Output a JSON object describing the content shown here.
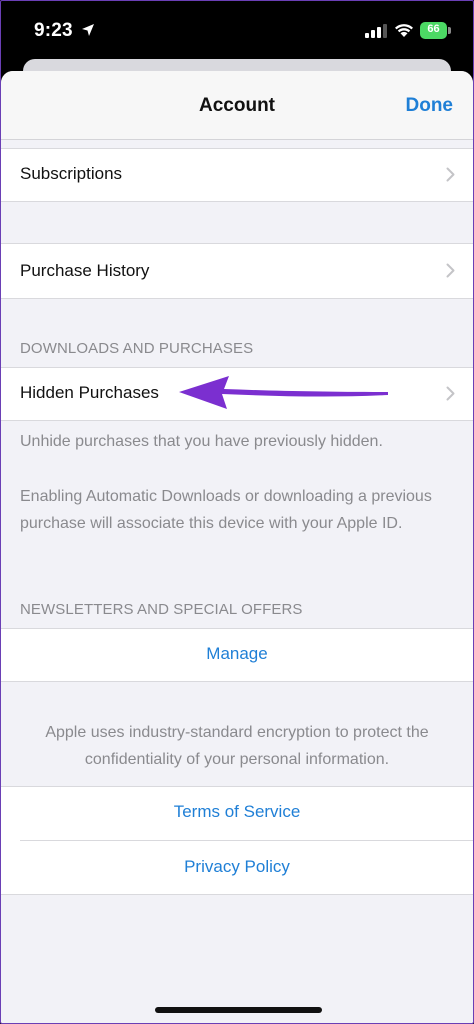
{
  "status_bar": {
    "time": "9:23",
    "battery_level": "66"
  },
  "nav": {
    "title": "Account",
    "done_label": "Done"
  },
  "rows": {
    "subscriptions": "Subscriptions",
    "purchase_history": "Purchase History",
    "hidden_purchases": "Hidden Purchases"
  },
  "sections": {
    "downloads_header": "DOWNLOADS AND PURCHASES",
    "hidden_footer": "Unhide purchases that you have previously hidden.",
    "downloads_note": "Enabling Automatic Downloads or downloading a previous purchase will associate this device with your Apple ID.",
    "newsletters_header": "NEWSLETTERS AND SPECIAL OFFERS",
    "manage_label": "Manage",
    "encryption_note": "Apple uses industry-standard encryption to protect the confidentiality of your personal information.",
    "terms_label": "Terms of Service",
    "privacy_label": "Privacy Policy"
  },
  "colors": {
    "accent": "#1f7fd6",
    "annotation_arrow": "#7b2fd0",
    "battery": "#4cd964"
  },
  "icons": [
    "location-arrow-icon",
    "cellular-signal-icon",
    "wifi-icon",
    "battery-icon",
    "chevron-right-icon",
    "annotation-arrow-icon"
  ]
}
